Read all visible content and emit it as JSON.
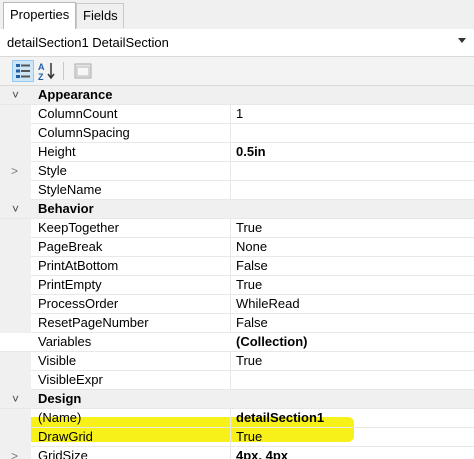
{
  "tabs": [
    {
      "label": "Properties",
      "active": true
    },
    {
      "label": "Fields",
      "active": false
    }
  ],
  "selector": {
    "value": "detailSection1  DetailSection"
  },
  "toolbar": {
    "categorized_icon": "categorized-icon",
    "alphabetical_icon": "sort-alphabetical-icon",
    "property_pages_icon": "property-pages-icon"
  },
  "highlight_color": "#f7f000",
  "categories": [
    {
      "label": "Appearance",
      "rows": [
        {
          "name": "ColumnCount",
          "value": "1",
          "bold": false,
          "expandable": false
        },
        {
          "name": "ColumnSpacing",
          "value": "",
          "bold": false,
          "expandable": false
        },
        {
          "name": "Height",
          "value": "0.5in",
          "bold": true,
          "expandable": false
        },
        {
          "name": "Style",
          "value": "",
          "bold": false,
          "expandable": true
        },
        {
          "name": "StyleName",
          "value": "",
          "bold": false,
          "expandable": false
        }
      ]
    },
    {
      "label": "Behavior",
      "rows": [
        {
          "name": "KeepTogether",
          "value": "True",
          "bold": false,
          "expandable": false
        },
        {
          "name": "PageBreak",
          "value": "None",
          "bold": false,
          "expandable": false
        },
        {
          "name": "PrintAtBottom",
          "value": "False",
          "bold": false,
          "expandable": false
        },
        {
          "name": "PrintEmpty",
          "value": "True",
          "bold": false,
          "expandable": false
        },
        {
          "name": "ProcessOrder",
          "value": "WhileRead",
          "bold": false,
          "expandable": false
        },
        {
          "name": "ResetPageNumber",
          "value": "False",
          "bold": false,
          "expandable": false
        },
        {
          "name": "Variables",
          "value": "(Collection)",
          "bold": true,
          "expandable": false,
          "highlighted": true
        },
        {
          "name": "Visible",
          "value": "True",
          "bold": false,
          "expandable": false
        },
        {
          "name": "VisibleExpr",
          "value": "",
          "bold": false,
          "expandable": false
        }
      ]
    },
    {
      "label": "Design",
      "rows": [
        {
          "name": "(Name)",
          "value": "detailSection1",
          "bold": true,
          "expandable": false
        },
        {
          "name": "DrawGrid",
          "value": "True",
          "bold": false,
          "expandable": false
        },
        {
          "name": "GridSize",
          "value": "4px, 4px",
          "bold": true,
          "expandable": true
        }
      ]
    }
  ]
}
